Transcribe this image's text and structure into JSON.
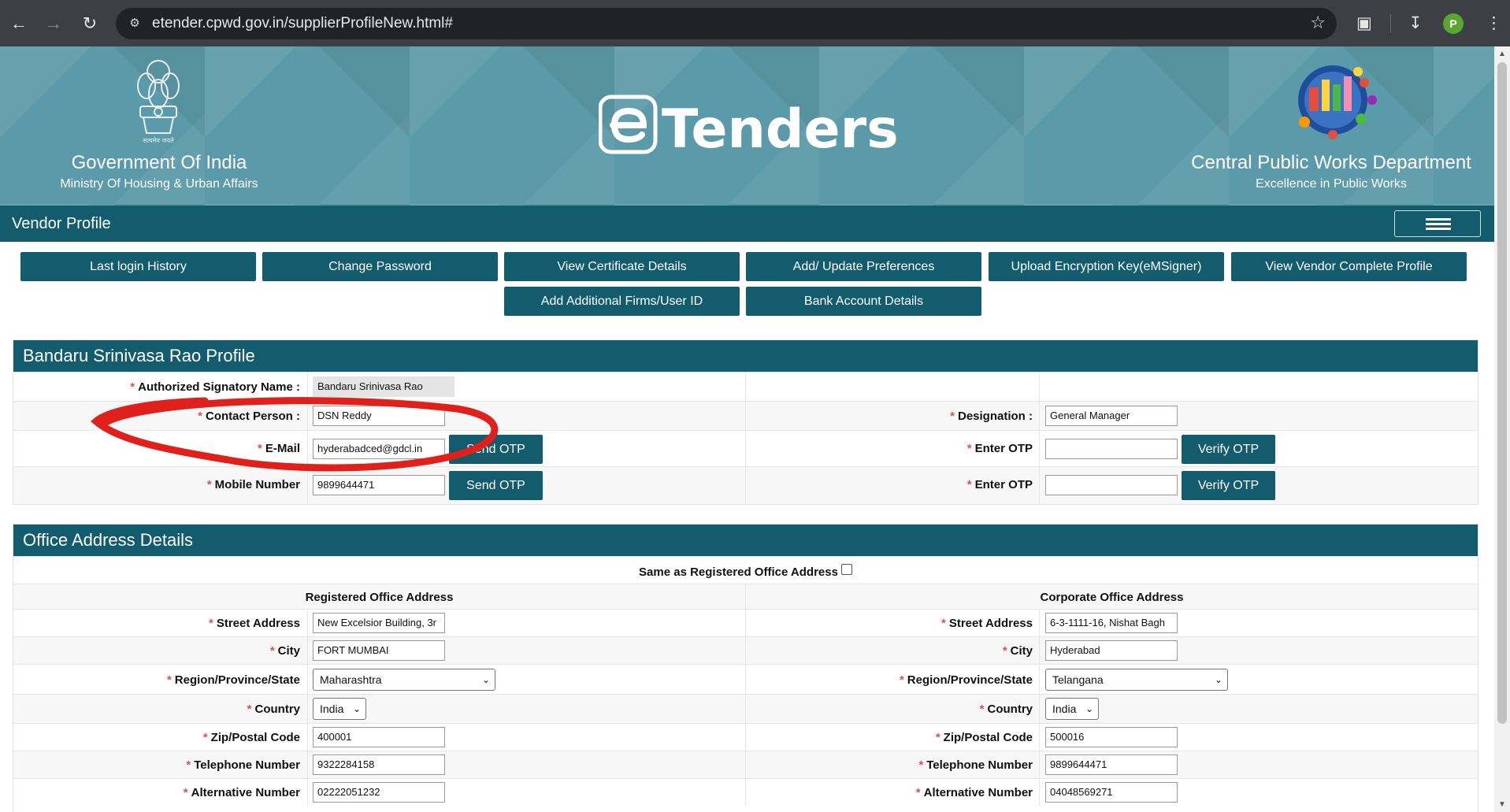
{
  "browser": {
    "url": "etender.cpwd.gov.in/supplierProfileNew.html#",
    "profile_initial": "P"
  },
  "header": {
    "gov_title": "Government Of India",
    "gov_subtitle": "Ministry Of Housing & Urban Affairs",
    "logo_text": "Tenders",
    "emblem_caption": "सत्यमेव जयते",
    "dept_title": "Central Public Works Department",
    "dept_subtitle": "Excellence in Public Works"
  },
  "vendor_bar": {
    "title": "Vendor Profile"
  },
  "actions": [
    "Last login History",
    "Change Password",
    "View Certificate Details",
    "Add/ Update Preferences",
    "Upload Encryption Key(eMSigner)",
    "View Vendor Complete Profile",
    "Add Additional Firms/User ID",
    "Bank Account Details"
  ],
  "profile": {
    "heading": "Bandaru Srinivasa Rao Profile",
    "authorized_label": "Authorized Signatory Name :",
    "authorized_value": "Bandaru Srinivasa Rao",
    "contact_label": "Contact Person :",
    "contact_value": "DSN Reddy",
    "designation_label": "Designation :",
    "designation_value": "General Manager",
    "email_label": "E-Mail",
    "email_value": "hyderabadced@gdcl.in",
    "mobile_label": "Mobile Number",
    "mobile_value": "9899644471",
    "send_otp": "Send OTP",
    "enter_otp_label": "Enter OTP",
    "verify_otp": "Verify OTP"
  },
  "office": {
    "heading": "Office Address Details",
    "same_as_label": "Same as Registered Office Address",
    "registered_heading": "Registered Office Address",
    "corporate_heading": "Corporate Office Address",
    "labels": {
      "street": "Street Address",
      "city": "City",
      "region": "Region/Province/State",
      "country": "Country",
      "zip": "Zip/Postal Code",
      "telephone": "Telephone Number",
      "alternative": "Alternative Number"
    },
    "registered": {
      "street": "New Excelsior Building, 3r",
      "city": "FORT MUMBAI",
      "region": "Maharashtra",
      "country": "India",
      "zip": "400001",
      "telephone": "9322284158",
      "alternative": "02222051232"
    },
    "corporate": {
      "street": "6-3-1111-16, Nishat Bagh",
      "city": "Hyderabad",
      "region": "Telangana",
      "country": "India",
      "zip": "500016",
      "telephone": "9899644471",
      "alternative": "04048569271"
    }
  },
  "colors": {
    "banner": "#5b9aa8",
    "primary": "#135c6e",
    "required": "#d9534f",
    "annotation": "#e0201b"
  }
}
